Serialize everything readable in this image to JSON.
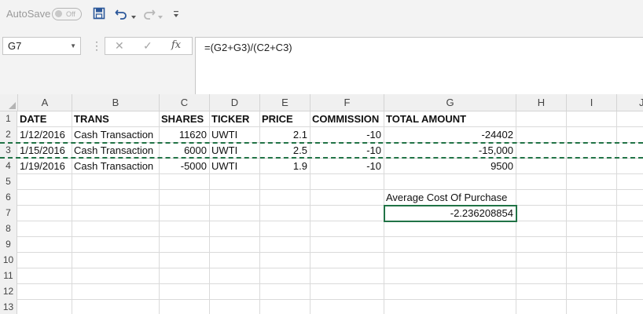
{
  "quick_access": {
    "autosave_label": "AutoSave",
    "autosave_state": "Off"
  },
  "formula_bar": {
    "name_box": "G7",
    "fx_label": "fx",
    "formula": "=(G2+G3)/(C2+C3)"
  },
  "columns": [
    "A",
    "B",
    "C",
    "D",
    "E",
    "F",
    "G",
    "H",
    "I",
    "J"
  ],
  "rows": [
    {
      "num": "1",
      "cells": [
        "DATE",
        "TRANS",
        "SHARES",
        "TICKER",
        "PRICE",
        "COMMISSION",
        "TOTAL AMOUNT",
        "",
        "",
        ""
      ]
    },
    {
      "num": "2",
      "cells": [
        "1/12/2016",
        "Cash Transaction",
        "11620",
        "UWTI",
        "2.1",
        "-10",
        "-24402",
        "",
        "",
        ""
      ]
    },
    {
      "num": "3",
      "cells": [
        "1/15/2016",
        "Cash Transaction",
        "6000",
        "UWTI",
        "2.5",
        "-10",
        "-15,000",
        "",
        "",
        ""
      ]
    },
    {
      "num": "4",
      "cells": [
        "1/19/2016",
        "Cash Transaction",
        "-5000",
        "UWTI",
        "1.9",
        "-10",
        "9500",
        "",
        "",
        ""
      ]
    },
    {
      "num": "5",
      "cells": [
        "",
        "",
        "",
        "",
        "",
        "",
        "",
        "",
        "",
        ""
      ]
    },
    {
      "num": "6",
      "cells": [
        "",
        "",
        "",
        "",
        "",
        "",
        "Average Cost Of Purchase",
        "",
        "",
        ""
      ]
    },
    {
      "num": "7",
      "cells": [
        "",
        "",
        "",
        "",
        "",
        "",
        "-2.236208854",
        "",
        "",
        ""
      ]
    },
    {
      "num": "8",
      "cells": [
        "",
        "",
        "",
        "",
        "",
        "",
        "",
        "",
        "",
        ""
      ]
    },
    {
      "num": "9",
      "cells": [
        "",
        "",
        "",
        "",
        "",
        "",
        "",
        "",
        "",
        ""
      ]
    },
    {
      "num": "10",
      "cells": [
        "",
        "",
        "",
        "",
        "",
        "",
        "",
        "",
        "",
        ""
      ]
    },
    {
      "num": "11",
      "cells": [
        "",
        "",
        "",
        "",
        "",
        "",
        "",
        "",
        "",
        ""
      ]
    },
    {
      "num": "12",
      "cells": [
        "",
        "",
        "",
        "",
        "",
        "",
        "",
        "",
        "",
        ""
      ]
    },
    {
      "num": "13",
      "cells": [
        "",
        "",
        "",
        "",
        "",
        "",
        "",
        "",
        "",
        ""
      ]
    }
  ],
  "colors": {
    "accent": "#217346",
    "save_icon": "#2b579a"
  }
}
